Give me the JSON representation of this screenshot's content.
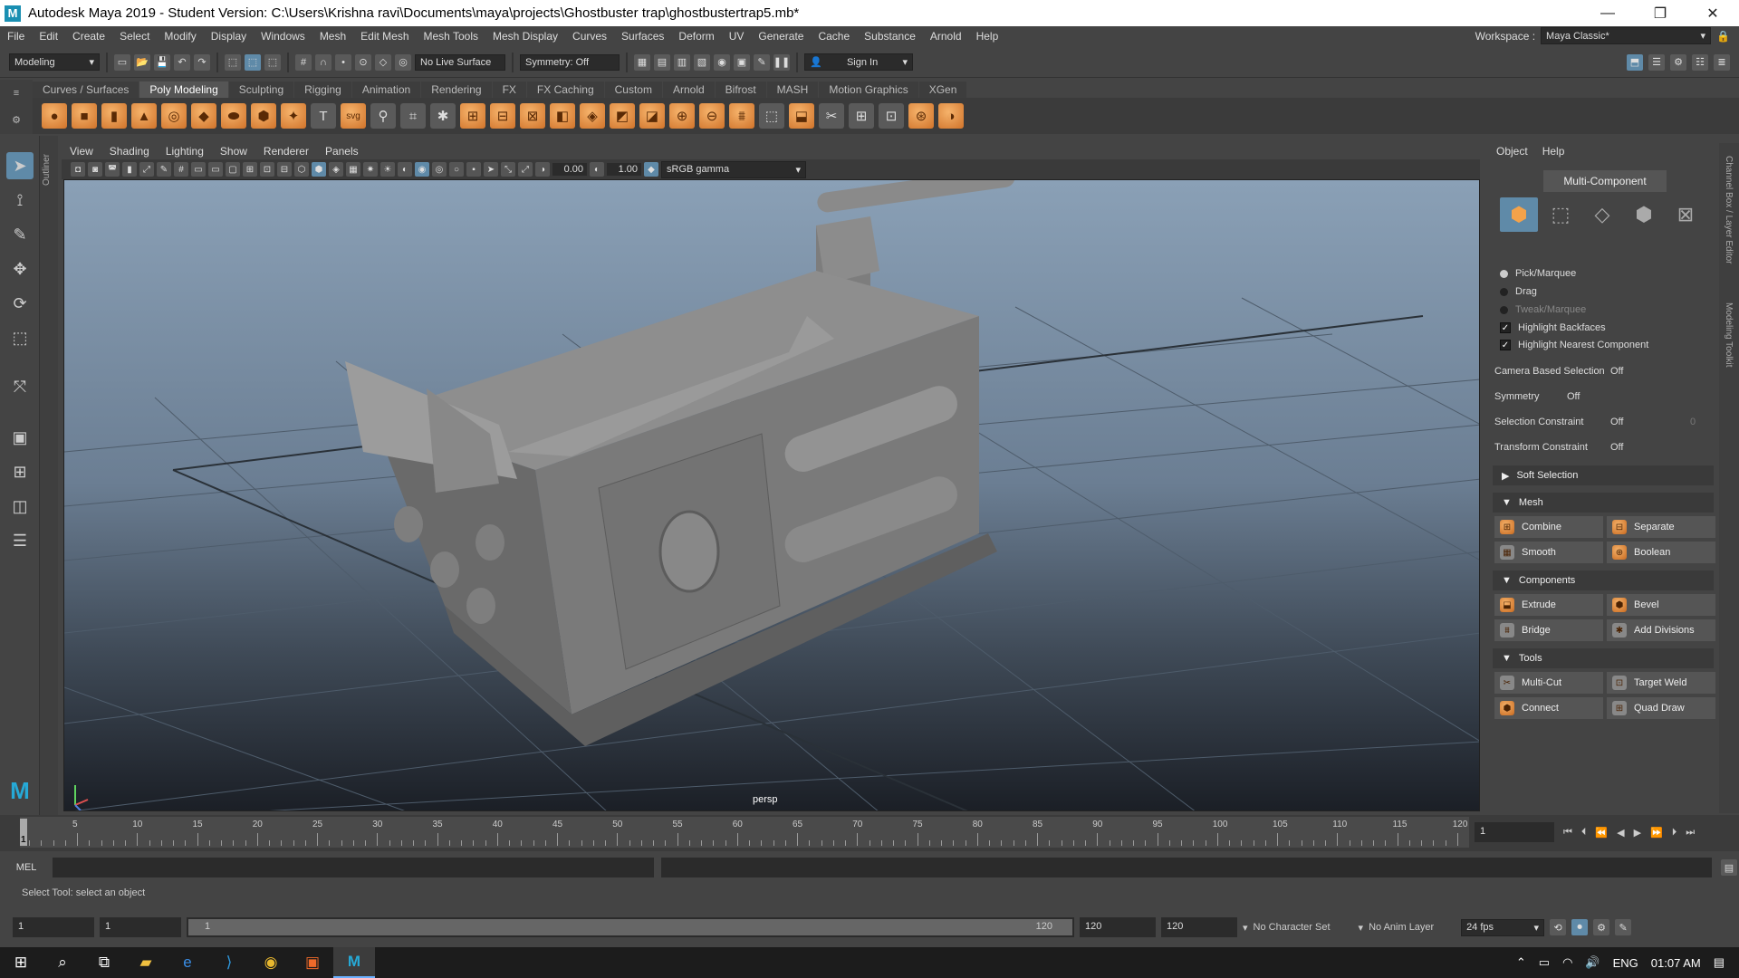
{
  "titlebar": {
    "title": "Autodesk Maya 2019 - Student Version: C:\\Users\\Krishna ravi\\Documents\\maya\\projects\\Ghostbuster trap\\ghostbustertrap5.mb*",
    "logo": "M",
    "min": "—",
    "max": "❐",
    "close": "✕"
  },
  "menubar": {
    "items": [
      "File",
      "Edit",
      "Create",
      "Select",
      "Modify",
      "Display",
      "Windows",
      "Mesh",
      "Edit Mesh",
      "Mesh Tools",
      "Mesh Display",
      "Curves",
      "Surfaces",
      "Deform",
      "UV",
      "Generate",
      "Cache",
      "Substance",
      "Arnold",
      "Help"
    ],
    "workspace_label": "Workspace :",
    "workspace_value": "Maya Classic*"
  },
  "statusline": {
    "mode": "Modeling",
    "live_surface": "No Live Surface",
    "symmetry": "Symmetry: Off",
    "sign_in": "Sign In"
  },
  "shelf": {
    "tabs": [
      "Curves / Surfaces",
      "Poly Modeling",
      "Sculpting",
      "Rigging",
      "Animation",
      "Rendering",
      "FX",
      "FX Caching",
      "Custom",
      "Arnold",
      "Bifrost",
      "MASH",
      "Motion Graphics",
      "XGen"
    ],
    "active_tab": "Poly Modeling",
    "svg_label": "svg",
    "text_label": "T"
  },
  "viewport": {
    "menu": [
      "View",
      "Shading",
      "Lighting",
      "Show",
      "Renderer",
      "Panels"
    ],
    "exposure": "0.00",
    "gamma": "1.00",
    "color_space": "sRGB gamma",
    "camera": "persp",
    "outliner_label": "Outliner"
  },
  "modeling_toolkit": {
    "menu": [
      "Object",
      "Help"
    ],
    "mode": "Multi-Component",
    "pick_marquee": "Pick/Marquee",
    "drag": "Drag",
    "tweak_marquee": "Tweak/Marquee",
    "highlight_backfaces": "Highlight Backfaces",
    "highlight_nearest": "Highlight Nearest Component",
    "camera_based_selection": {
      "label": "Camera Based Selection",
      "value": "Off"
    },
    "symmetry": {
      "label": "Symmetry",
      "value": "Off"
    },
    "selection_constraint": {
      "label": "Selection Constraint",
      "value": "Off",
      "extra": "0"
    },
    "transform_constraint": {
      "label": "Transform Constraint",
      "value": "Off"
    },
    "soft_selection": "Soft Selection",
    "mesh_section": "Mesh",
    "combine": "Combine",
    "separate": "Separate",
    "smooth": "Smooth",
    "boolean": "Boolean",
    "components_section": "Components",
    "extrude": "Extrude",
    "bevel": "Bevel",
    "bridge": "Bridge",
    "add_divisions": "Add Divisions",
    "tools_section": "Tools",
    "multi_cut": "Multi-Cut",
    "target_weld": "Target Weld",
    "connect": "Connect",
    "quad_draw": "Quad Draw",
    "side_tabs": {
      "channel_box": "Channel Box / Layer Editor",
      "modeling_toolkit": "Modeling Toolkit"
    }
  },
  "timeline": {
    "ticks": [
      "5",
      "10",
      "15",
      "20",
      "25",
      "30",
      "35",
      "40",
      "45",
      "50",
      "55",
      "60",
      "65",
      "70",
      "75",
      "80",
      "85",
      "90",
      "95",
      "100",
      "105",
      "110",
      "115",
      "120"
    ],
    "start_marker": "1",
    "current_frame": "1"
  },
  "cmdline": {
    "label": "MEL",
    "help": "Select Tool: select an object"
  },
  "range": {
    "start": "1",
    "anim_start": "1",
    "slider_start": "1",
    "slider_end": "120",
    "anim_end": "120",
    "end": "120",
    "character_set": "No Character Set",
    "anim_layer": "No Anim Layer",
    "fps": "24 fps"
  },
  "taskbar": {
    "language": "ENG",
    "time": "01:07 AM"
  }
}
